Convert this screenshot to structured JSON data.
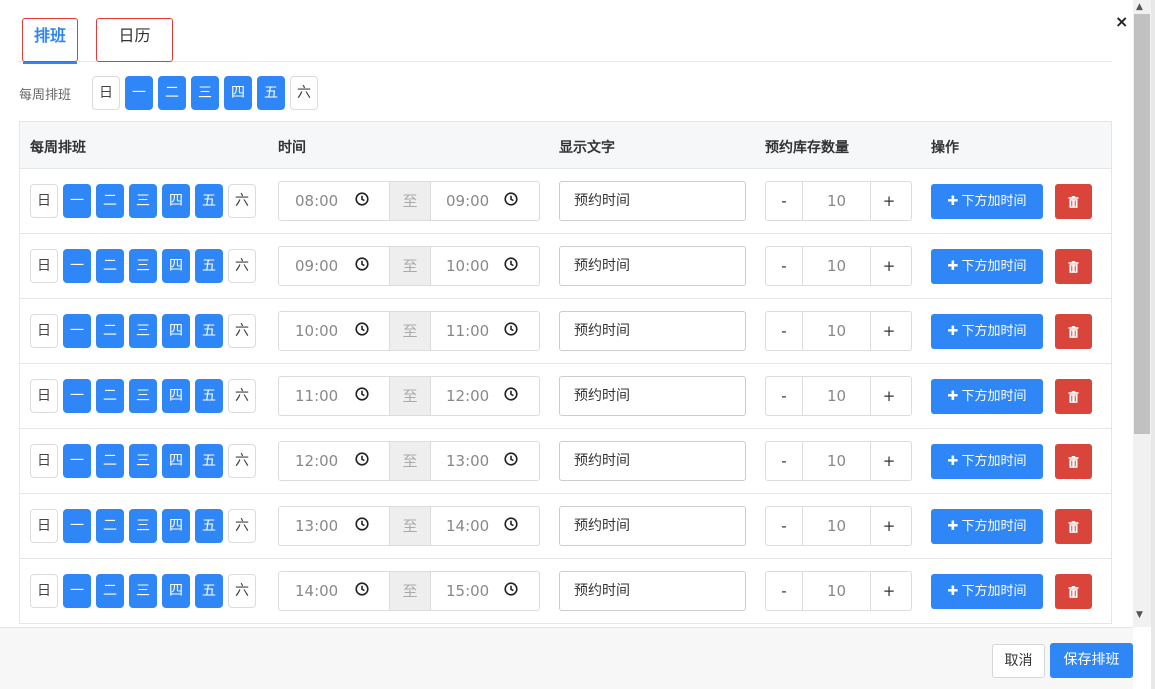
{
  "close_symbol": "×",
  "tabs": [
    {
      "label": "排班"
    },
    {
      "label": "日历"
    }
  ],
  "weekly": {
    "label": "每周排班",
    "days": [
      {
        "label": "日",
        "on": false
      },
      {
        "label": "一",
        "on": true
      },
      {
        "label": "二",
        "on": true
      },
      {
        "label": "三",
        "on": true
      },
      {
        "label": "四",
        "on": true
      },
      {
        "label": "五",
        "on": true
      },
      {
        "label": "六",
        "on": false
      }
    ]
  },
  "table": {
    "headers": {
      "week": "每周排班",
      "time": "时间",
      "text": "显示文字",
      "stock": "预约库存数量",
      "ops": "操作"
    },
    "to_label": "至",
    "minus": "-",
    "plus": "+",
    "add_label": "下方加时间",
    "rows": [
      {
        "start": "08:00",
        "end": "09:00",
        "text": "预约时间",
        "qty": "10"
      },
      {
        "start": "09:00",
        "end": "10:00",
        "text": "预约时间",
        "qty": "10"
      },
      {
        "start": "10:00",
        "end": "11:00",
        "text": "预约时间",
        "qty": "10"
      },
      {
        "start": "11:00",
        "end": "12:00",
        "text": "预约时间",
        "qty": "10"
      },
      {
        "start": "12:00",
        "end": "13:00",
        "text": "预约时间",
        "qty": "10"
      },
      {
        "start": "13:00",
        "end": "14:00",
        "text": "预约时间",
        "qty": "10"
      },
      {
        "start": "14:00",
        "end": "15:00",
        "text": "预约时间",
        "qty": "10"
      }
    ]
  },
  "footer": {
    "cancel": "取消",
    "save": "保存排班"
  },
  "colors": {
    "primary": "#2f86f6",
    "danger": "#d9443b",
    "highlight_border": "#e53935"
  },
  "icons": {
    "close": "close-icon",
    "clock": "clock-icon",
    "add": "plus-icon",
    "delete": "trash-icon"
  }
}
